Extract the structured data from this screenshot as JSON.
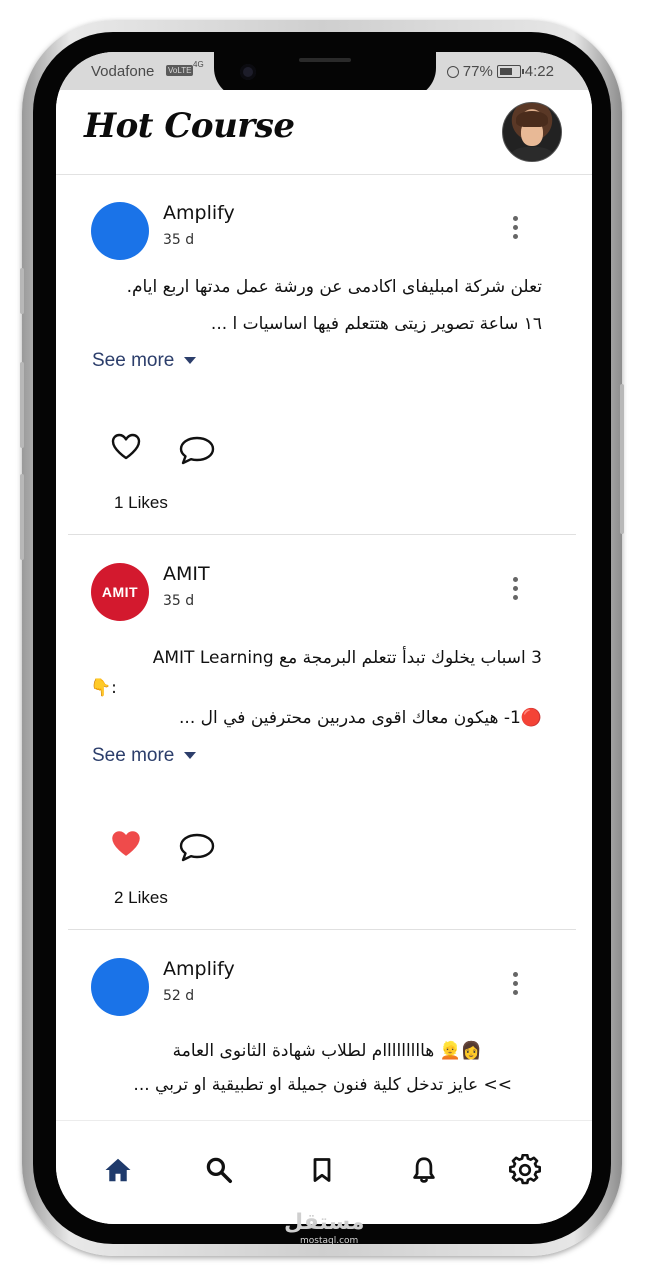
{
  "status_bar": {
    "carrier": "Vodafone",
    "volte": "VoLTE",
    "network": "4G",
    "battery": "77%",
    "time": "4:22"
  },
  "header": {
    "logo": "Hot Course"
  },
  "posts": [
    {
      "author": "Amplify",
      "time": "35 d",
      "text_line1": "تعلن شركة امبليفاى اكادمى عن ورشة عمل مدتها اربع ايام.",
      "text_line2": "١٦ ساعة  تصوير زيتى هتتعلم فيها اساسيات ا ...",
      "see_more": "See more",
      "liked": false,
      "likes": "1 Likes"
    },
    {
      "author": "AMIT",
      "avatar_text": "AMIT",
      "time": "35 d",
      "text_line1": "3 اسباب يخلوك تبدأ تتعلم البرمجة مع AMIT Learning",
      "text_line2": ":👇",
      "text_line3": "🔴1- هيكون معاك اقوى مدربين محترفين في ال ...",
      "see_more": "See more",
      "liked": true,
      "likes": "2 Likes"
    },
    {
      "author": "Amplify",
      "time": "52 d",
      "text_line1": "👩👱 هااااااااام لطلاب  شهادة الثانوى العامة",
      "text_line2": ">> عايز تدخل كلية فنون جميلة او تطبيقية او تربي ..."
    }
  ],
  "nav": {
    "items": [
      "home-icon",
      "search-icon",
      "bookmark-icon",
      "bell-icon",
      "gear-icon"
    ],
    "active": "home-icon",
    "active_color": "#1f3a6b"
  },
  "watermark": {
    "text": "مستقل",
    "sub": "mostaql.com"
  }
}
